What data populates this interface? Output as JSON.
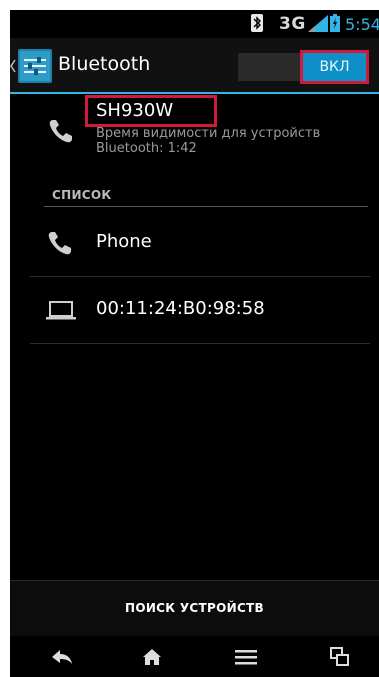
{
  "status_bar": {
    "network": "3G",
    "time": "5:54",
    "icons": [
      "bluetooth-icon",
      "signal-icon",
      "battery-icon"
    ]
  },
  "action_bar": {
    "title": "Bluetooth",
    "toggle_label": "ВКЛ",
    "icon": "bluetooth-settings-icon"
  },
  "device": {
    "name": "SH930W",
    "visibility_text": "Время видимости для устройств Bluetooth: 1:42",
    "icon": "phone-icon"
  },
  "list": {
    "header": "СПИСОК",
    "items": [
      {
        "label": "Phone",
        "icon": "phone-icon"
      },
      {
        "label": "00:11:24:B0:98:58",
        "icon": "laptop-icon"
      }
    ]
  },
  "scan_button": {
    "label": "ПОИСК УСТРОЙСТВ"
  },
  "nav_bar": {
    "buttons": [
      "back-icon",
      "home-icon",
      "menu-icon",
      "recent-apps-icon"
    ]
  },
  "colors": {
    "accent": "#33b5e5",
    "toggle_on": "#0f8fc8",
    "highlight_box": "#d11a3b"
  }
}
